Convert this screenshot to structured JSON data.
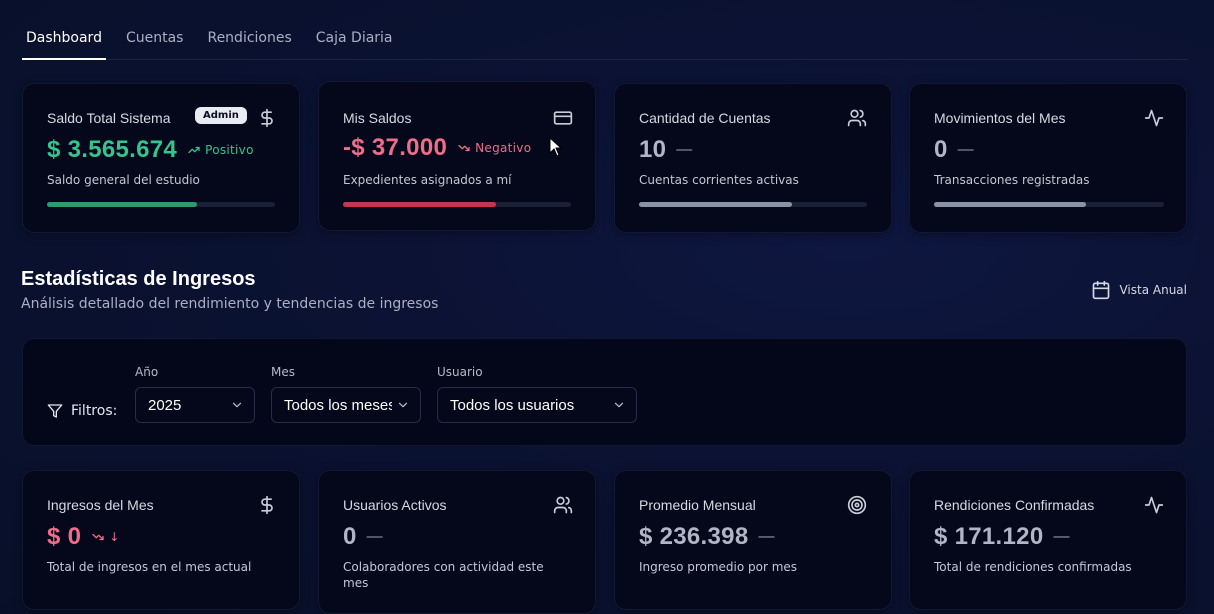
{
  "tabs": [
    "Dashboard",
    "Cuentas",
    "Rendiciones",
    "Caja Diaria"
  ],
  "top_cards": [
    {
      "title": "Saldo Total Sistema",
      "badge": "Admin",
      "value": "$ 3.565.674",
      "trend": "Positivo",
      "desc": "Saldo general del estudio",
      "icon": "dollar-icon",
      "progress": 0.66,
      "color": "#34c58f"
    },
    {
      "title": "Mis Saldos",
      "value": "-$ 37.000",
      "trend": "Negativo",
      "desc": "Expedientes asignados a mí",
      "icon": "credit-card-icon",
      "progress": 0.67,
      "color": "#f06d8a"
    },
    {
      "title": "Cantidad de Cuentas",
      "value": "10",
      "trend": "—",
      "desc": "Cuentas corrientes activas",
      "icon": "users-icon",
      "progress": 0.67,
      "color": "#b0b6c6"
    },
    {
      "title": "Movimientos del Mes",
      "value": "0",
      "trend": "—",
      "desc": "Transacciones registradas",
      "icon": "activity-icon",
      "progress": 0.66,
      "color": "#b0b6c6"
    }
  ],
  "section": {
    "title": "Estadísticas de Ingresos",
    "subtitle": "Análisis detallado del rendimiento y tendencias de ingresos",
    "vista": "Vista Anual"
  },
  "filters": {
    "label": "Filtros:",
    "year_label": "Año",
    "year_value": "2025",
    "month_label": "Mes",
    "month_value": "Todos los meses",
    "user_label": "Usuario",
    "user_value": "Todos los usuarios"
  },
  "bottom_cards": [
    {
      "title": "Ingresos del Mes",
      "value": "$ 0",
      "trend": "↓",
      "desc": "Total de ingresos en el mes actual",
      "icon": "dollar-icon",
      "color": "#f06d8a"
    },
    {
      "title": "Usuarios Activos",
      "value": "0",
      "trend": "—",
      "desc": "Colaboradores con actividad este mes",
      "icon": "users-icon",
      "color": "#b0b6c6"
    },
    {
      "title": "Promedio Mensual",
      "value": "$ 236.398",
      "trend": "—",
      "desc": "Ingreso promedio por mes",
      "icon": "target-icon",
      "color": "#b0b6c6"
    },
    {
      "title": "Rendiciones Confirmadas",
      "value": "$ 171.120",
      "trend": "—",
      "desc": "Total de rendiciones confirmadas",
      "icon": "activity-icon",
      "color": "#b0b6c6"
    }
  ]
}
